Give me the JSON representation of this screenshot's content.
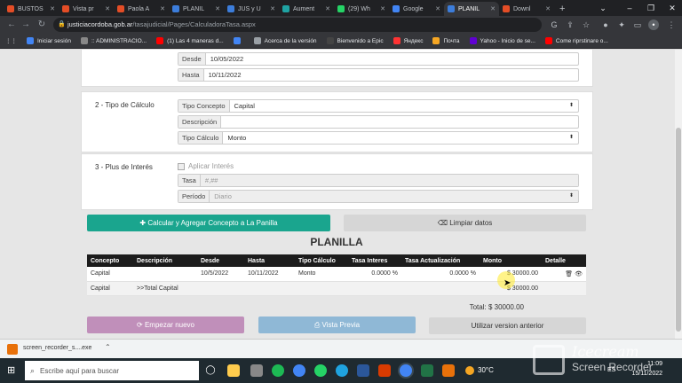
{
  "browser": {
    "tabs": [
      {
        "label": "BUSTOS",
        "color": "#e44d26"
      },
      {
        "label": "Vista pr",
        "color": "#e44d26"
      },
      {
        "label": "Paola A",
        "color": "#e44d26"
      },
      {
        "label": "PLANIL",
        "color": "#3c7ddb"
      },
      {
        "label": "JUS y U",
        "color": "#3c7ddb"
      },
      {
        "label": "Aument",
        "color": "#1fa3a3"
      },
      {
        "label": "(29) Wh",
        "color": "#25d366"
      },
      {
        "label": "Google",
        "color": "#4285f4"
      },
      {
        "label": "PLANIL",
        "color": "#3c7ddb",
        "active": true
      },
      {
        "label": "Downl",
        "color": "#e44d26"
      }
    ],
    "url_host": "justiciacordoba.gob.ar",
    "url_path": "/tasajudicial/Pages/CalculadoraTasa.aspx",
    "bookmarks": [
      {
        "label": "Iniciar sesión",
        "color": "#4285f4"
      },
      {
        "label": ":: ADMINISTRACIO...",
        "color": "#888888"
      },
      {
        "label": "(1) Las 4 maneras d...",
        "color": "#ff0000"
      },
      {
        "label": "",
        "color": "#4285f4"
      },
      {
        "label": "Acerca de la versión",
        "color": "#9aa0a6"
      },
      {
        "label": "Bienvenido a Epic",
        "color": "#444444"
      },
      {
        "label": "Яндекс",
        "color": "#ff3333"
      },
      {
        "label": "Почта",
        "color": "#f5a623"
      },
      {
        "label": "Yahoo - Inicio de se...",
        "color": "#6001d2"
      },
      {
        "label": "Come riprstinare o...",
        "color": "#ff0000"
      }
    ]
  },
  "form": {
    "desde_label": "Desde",
    "desde_value": "10/05/2022",
    "hasta_label": "Hasta",
    "hasta_value": "10/11/2022",
    "section2_title": "2 - Tipo de Cálculo",
    "tipo_concepto_label": "Tipo Concepto",
    "tipo_concepto_value": "Capital",
    "descripcion_label": "Descripción",
    "descripcion_value": "",
    "tipo_calculo_label": "Tipo Cálculo",
    "tipo_calculo_value": "Monto",
    "section3_title": "3 - Plus de Interés",
    "aplicar_interes_label": "Aplicar Interés",
    "tasa_label": "Tasa",
    "tasa_placeholder": "#,##",
    "periodo_label": "Período",
    "periodo_value": "Diario"
  },
  "actions": {
    "calcular_label": "Calcular y Agregar Concepto a La Panilla",
    "limpiar_label": "Limpiar datos"
  },
  "planilla": {
    "title": "PLANILLA",
    "headers": [
      "Concepto",
      "Descripción",
      "Desde",
      "Hasta",
      "Tipo Cálculo",
      "Tasa Interes",
      "Tasa Actualización",
      "Monto",
      "Detalle"
    ],
    "row": {
      "concepto": "Capital",
      "descripcion": "",
      "desde": "10/5/2022",
      "hasta": "10/11/2022",
      "tipo_calculo": "Monto",
      "tasa_interes": "0.0000 %",
      "tasa_actualizacion": "0.0000 %",
      "monto": "$ 30000.00"
    },
    "total_row": {
      "concepto": "Capital",
      "descripcion": ">>Total Capital",
      "monto": "$ 30000.00"
    },
    "total_label": "Total: $ 30000.00"
  },
  "footer_buttons": {
    "empezar_label": "Empezar nuevo",
    "vista_label": "Vista Previa",
    "utilizar_label": "Utilizar version anterior"
  },
  "download": {
    "filename": "screen_recorder_s....exe"
  },
  "taskbar": {
    "search_placeholder": "Escribe aquí para buscar",
    "temperature": "30°C",
    "lang": "ES",
    "time": "11:09",
    "date": "15/11/2022"
  },
  "watermark": {
    "brand": "Icecream",
    "product": "Screen Recorder"
  },
  "colors": {
    "calcular": "#1aa58e",
    "limpiar": "#d6d6d6",
    "empezar": "#c08fba",
    "vista": "#8fb8d6",
    "utilizar": "#d6d6d6"
  }
}
